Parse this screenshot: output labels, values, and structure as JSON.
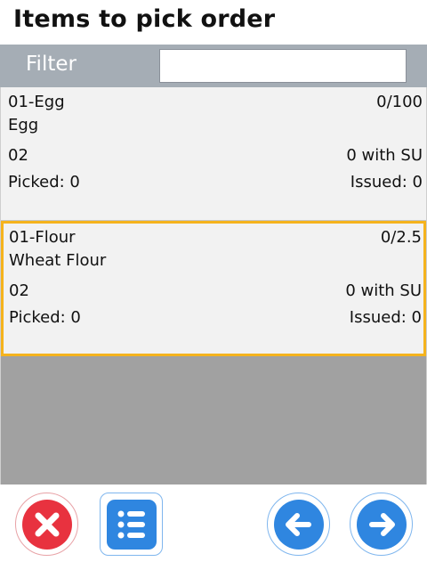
{
  "header": {
    "title": "Items to pick order"
  },
  "filter": {
    "label": "Filter",
    "value": "",
    "placeholder": ""
  },
  "items": [
    {
      "code": "01-Egg",
      "quantity": "0/100",
      "name": "Egg",
      "location": "02",
      "su_text": "0 with SU",
      "picked": "Picked: 0",
      "issued": "Issued: 0",
      "selected": false
    },
    {
      "code": "01-Flour",
      "quantity": "0/2.5",
      "name": "Wheat Flour",
      "location": "02",
      "su_text": "0 with SU",
      "picked": "Picked: 0",
      "issued": "Issued: 0",
      "selected": true
    }
  ],
  "toolbar": {
    "cancel_icon": "close-icon",
    "list_icon": "list-icon",
    "prev_icon": "arrow-left-icon",
    "next_icon": "arrow-right-icon"
  },
  "colors": {
    "filter_bar": "#a5adb5",
    "selection": "#f5b31d",
    "cancel": "#e8323f",
    "primary": "#2f86e0"
  }
}
